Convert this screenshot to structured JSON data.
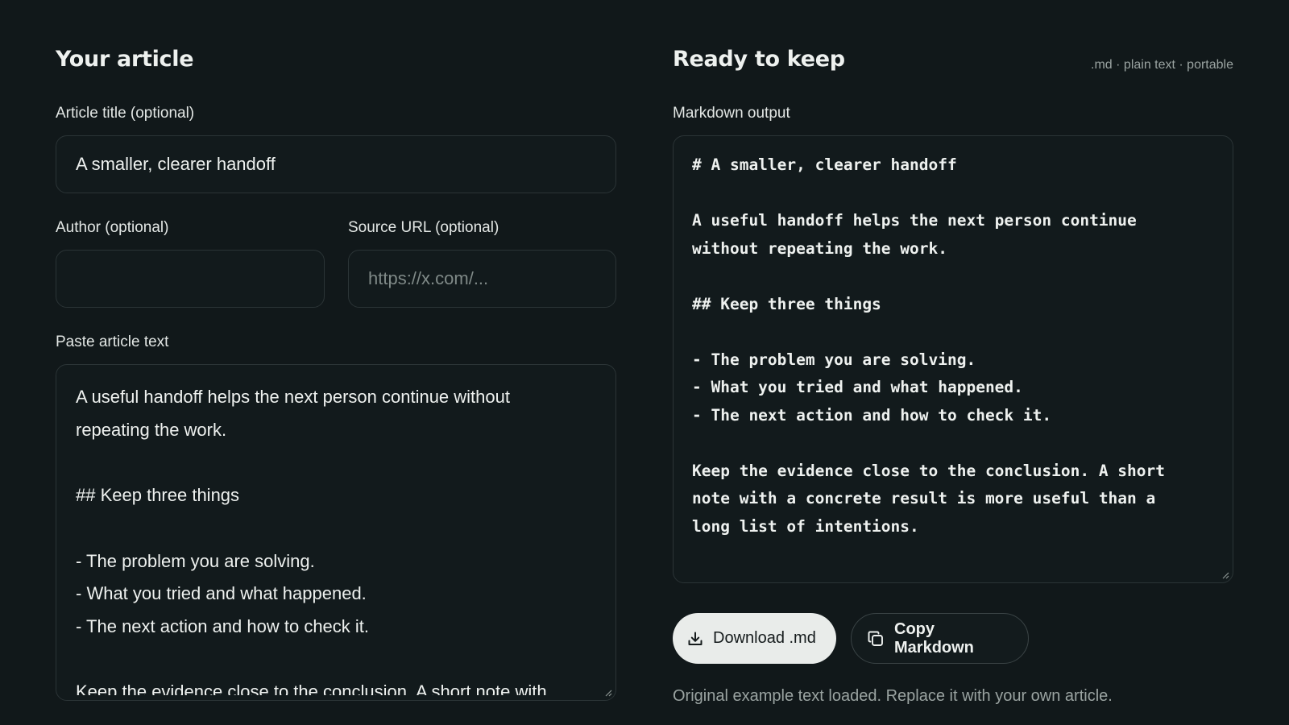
{
  "left": {
    "heading": "Your article",
    "title_label": "Article title (optional)",
    "title_value": "A smaller, clearer handoff",
    "author_label": "Author (optional)",
    "author_value": "",
    "source_label": "Source URL (optional)",
    "source_placeholder": "https://x.com/...",
    "paste_label": "Paste article text",
    "paste_value": "A useful handoff helps the next person continue without\nrepeating the work.\n\n## Keep three things\n\n- The problem you are solving.\n- What you tried and what happened.\n- The next action and how to check it.\n\nKeep the evidence close to the conclusion. A short note with"
  },
  "right": {
    "heading": "Ready to keep",
    "formats": ".md · plain text · portable",
    "output_label": "Markdown output",
    "markdown": "# A smaller, clearer handoff\n\nA useful handoff helps the next person continue\nwithout repeating the work.\n\n## Keep three things\n\n- The problem you are solving.\n- What you tried and what happened.\n- The next action and how to check it.\n\nKeep the evidence close to the conclusion. A short\nnote with a concrete result is more useful than a\nlong list of intentions.",
    "download_label": "Download .md",
    "copy_label": "Copy Markdown",
    "status": "Original example text loaded. Replace it with your own article."
  },
  "icons": {
    "download": "download-icon",
    "copy": "copy-icon",
    "resize": "resize-grip-icon"
  },
  "colors": {
    "background": "#11181a",
    "field_border": "#2b3436",
    "text": "#eef1ef",
    "muted": "#9aa3a1",
    "primary_button": "#e9ecea"
  }
}
